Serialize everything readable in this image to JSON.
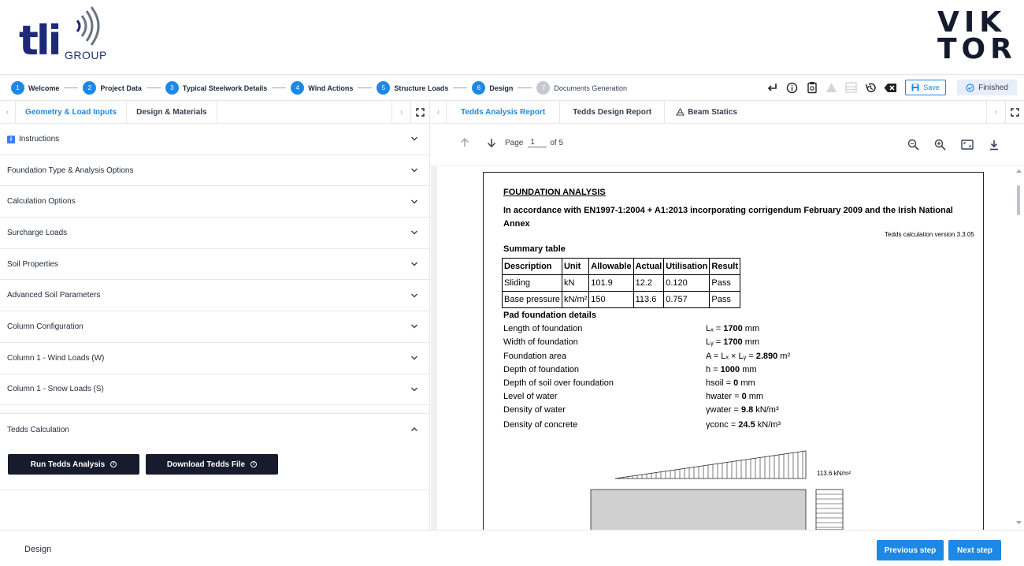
{
  "brand": {
    "tli_mark": "tli",
    "tli_group": "GROUP",
    "viktor_line1": "VIK",
    "viktor_line2": "TOR"
  },
  "stepper": {
    "steps": [
      {
        "num": "1",
        "label": "Welcome"
      },
      {
        "num": "2",
        "label": "Project Data"
      },
      {
        "num": "3",
        "label": "Typical Steelwork Details"
      },
      {
        "num": "4",
        "label": "Wind Actions"
      },
      {
        "num": "5",
        "label": "Structure Loads"
      },
      {
        "num": "6",
        "label": "Design"
      },
      {
        "num": "7",
        "label": "Documents Generation"
      }
    ],
    "save_label": "Save",
    "finished_label": "Finished"
  },
  "left_panel": {
    "tabs": [
      "Geometry & Load Inputs",
      "Design & Materials"
    ],
    "sections": [
      "Instructions",
      "Foundation Type & Analysis Options",
      "Calculation Options",
      "Surcharge Loads",
      "Soil Properties",
      "Advanced Soil Parameters",
      "Column Configuration",
      "Column 1 - Wind Loads (W)",
      "Column 1 - Snow Loads (S)"
    ],
    "tedds": {
      "title": "Tedds Calculation",
      "run_label": "Run Tedds Analysis",
      "download_label": "Download Tedds File"
    }
  },
  "right_panel": {
    "tabs": [
      "Tedds Analysis Report",
      "Tedds Design Report",
      "Beam Statics"
    ],
    "pdf": {
      "page_label": "Page",
      "page_value": "1",
      "page_total": "of 5"
    },
    "document": {
      "title": "FOUNDATION ANALYSIS",
      "subtitle": "In accordance with EN1997-1:2004 + A1:2013 incorporating corrigendum February 2009 and the Irish National Annex",
      "version": "Tedds calculation version 3.3.05",
      "summary_heading": "Summary table",
      "table_headers": [
        "Description",
        "Unit",
        "Allowable",
        "Actual",
        "Utilisation",
        "Result"
      ],
      "table_rows": [
        [
          "Sliding",
          "kN",
          "101.9",
          "12.2",
          "0.120",
          "Pass"
        ],
        [
          "Base pressure",
          "kN/m²",
          "150",
          "113.6",
          "0.757",
          "Pass"
        ]
      ],
      "pad_heading": "Pad foundation details",
      "properties": [
        {
          "label": "Length of foundation",
          "sym": "Lₓ = ",
          "val": "1700",
          "unit": " mm"
        },
        {
          "label": "Width of foundation",
          "sym": "Lᵧ = ",
          "val": "1700",
          "unit": " mm"
        },
        {
          "label": "Foundation area",
          "sym": "A = Lₓ × Lᵧ = ",
          "val": "2.890",
          "unit": " m²"
        },
        {
          "label": "Depth of foundation",
          "sym": "h = ",
          "val": "1000",
          "unit": " mm"
        },
        {
          "label": "Depth of soil over foundation",
          "sym": "hsoil = ",
          "val": "0",
          "unit": " mm"
        },
        {
          "label": "Level of water",
          "sym": "hwater = ",
          "val": "0",
          "unit": " mm"
        },
        {
          "label": "Density of water",
          "sym": "γwater = ",
          "val": "9.8",
          "unit": " kN/m³"
        },
        {
          "label": "Density of concrete",
          "sym": "γconc = ",
          "val": "24.5",
          "unit": " kN/m³"
        }
      ],
      "diagram_label": "113.6 kN/m²"
    }
  },
  "footer": {
    "title": "Design",
    "prev_label": "Previous step",
    "next_label": "Next step"
  },
  "colors": {
    "accent": "#1e88e5",
    "dark_button": "#171b2d",
    "logo_blue": "#1e2a78"
  }
}
